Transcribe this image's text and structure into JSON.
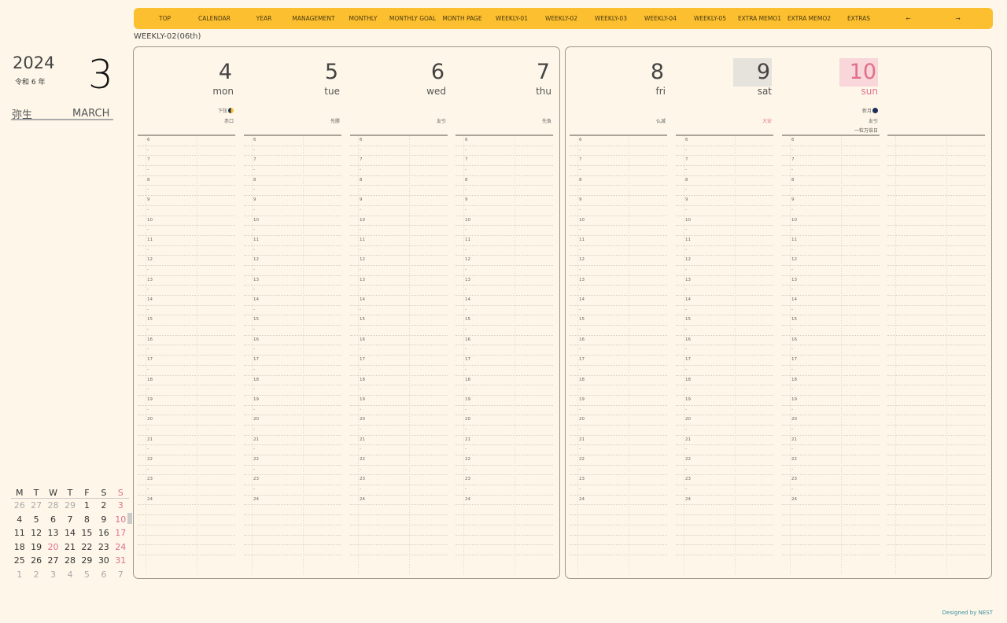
{
  "nav": {
    "tabs": [
      "TOP",
      "CALENDAR",
      "YEAR",
      "MANAGEMENT",
      "MONTHLY",
      "MONTHLY GOAL",
      "MONTH PAGE",
      "WEEKLY-01",
      "WEEKLY-02",
      "WEEKLY-03",
      "WEEKLY-04",
      "WEEKLY-05",
      "EXTRA MEMO1",
      "EXTRA MEMO2",
      "EXTRAS",
      "←",
      "→"
    ]
  },
  "page_title": "WEEKLY-02(06th)",
  "header": {
    "year": "2024",
    "era": "令和 6 年",
    "month_number": "3",
    "month_jp": "弥生",
    "month_en": "MARCH"
  },
  "mini_calendar": {
    "weekdays": [
      "M",
      "T",
      "W",
      "T",
      "F",
      "S",
      "S"
    ],
    "weeks": [
      [
        "26",
        "27",
        "28",
        "29",
        "1",
        "2",
        "3"
      ],
      [
        "4",
        "5",
        "6",
        "7",
        "8",
        "9",
        "10"
      ],
      [
        "11",
        "12",
        "13",
        "14",
        "15",
        "16",
        "17"
      ],
      [
        "18",
        "19",
        "20",
        "21",
        "22",
        "23",
        "24"
      ],
      [
        "25",
        "26",
        "27",
        "28",
        "29",
        "30",
        "31"
      ],
      [
        "1",
        "2",
        "3",
        "4",
        "5",
        "6",
        "7"
      ]
    ]
  },
  "days": [
    {
      "num": "4",
      "name": "mon",
      "moon": "下弦",
      "rokuyo": "赤口",
      "extra": ""
    },
    {
      "num": "5",
      "name": "tue",
      "moon": "",
      "rokuyo": "先勝",
      "extra": ""
    },
    {
      "num": "6",
      "name": "wed",
      "moon": "",
      "rokuyo": "友引",
      "extra": ""
    },
    {
      "num": "7",
      "name": "thu",
      "moon": "",
      "rokuyo": "先負",
      "extra": ""
    },
    {
      "num": "8",
      "name": "fri",
      "moon": "",
      "rokuyo": "仏滅",
      "extra": ""
    },
    {
      "num": "9",
      "name": "sat",
      "moon": "",
      "rokuyo": "大安",
      "extra": ""
    },
    {
      "num": "10",
      "name": "sun",
      "moon": "新月",
      "rokuyo": "友引",
      "extra": "一粒万倍日"
    }
  ],
  "hours": [
    "6",
    "7",
    "8",
    "9",
    "10",
    "11",
    "12",
    "13",
    "14",
    "15",
    "16",
    "17",
    "18",
    "19",
    "20",
    "21",
    "22",
    "23",
    "24"
  ],
  "half_mark": "-",
  "credit": "Designed by NEST",
  "colors": {
    "tab_bar": "#fcbf2f",
    "sunday": "#e0708a",
    "saturday_bg": "#e6e3dd",
    "sunday_bg": "#f8d6da",
    "background": "#fef7e9"
  }
}
